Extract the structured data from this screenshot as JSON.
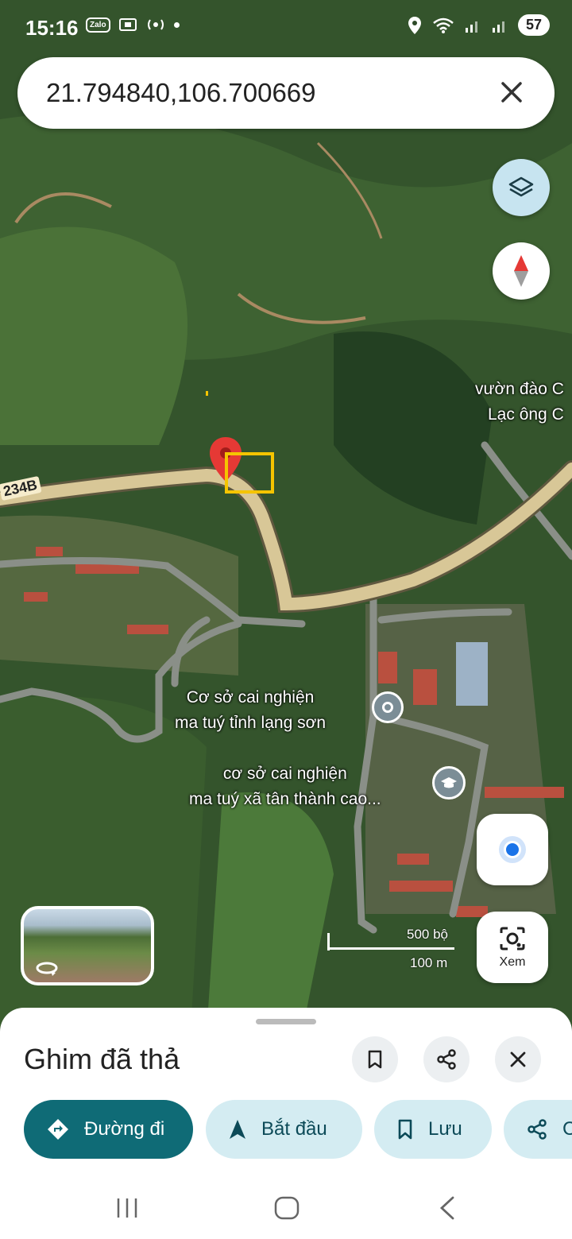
{
  "status_bar": {
    "time": "15:16",
    "zalo": "Zalo",
    "battery": "57"
  },
  "search": {
    "value": "21.794840,106.700669"
  },
  "map": {
    "road_label": "234B",
    "labels": {
      "garden_line1": "vườn đào C",
      "garden_line2": "Lạc ông C",
      "rehab1_line1": "Cơ sở cai nghiện",
      "rehab1_line2": "ma tuý tỉnh lạng sơn",
      "rehab2_line1": "cơ sở cai nghiện",
      "rehab2_line2": "ma tuý xã tân thành cao..."
    },
    "scale": {
      "top": "500 bộ",
      "bottom": "100 m"
    },
    "icons": {
      "layers": "layers-icon",
      "compass": "compass-icon",
      "locate": "my-location-icon",
      "lens": "lens-icon",
      "pin": "dropped-pin-icon"
    },
    "colors": {
      "pin": "#e53935",
      "highlight_box": "#f5c400",
      "road": "#d8c797",
      "locate_dot": "#1a73e8"
    }
  },
  "lens_button": {
    "label": "Xem"
  },
  "sheet": {
    "title": "Ghim đã thả",
    "actions": [
      {
        "label": "Đường đi",
        "icon": "directions-icon"
      },
      {
        "label": "Bắt đầu",
        "icon": "navigation-arrow-icon"
      },
      {
        "label": "Lưu",
        "icon": "bookmark-icon"
      },
      {
        "label": "C",
        "icon": "share-icon"
      }
    ],
    "colors": {
      "primary": "#0f6b76",
      "secondary": "#d4ecf2"
    }
  }
}
